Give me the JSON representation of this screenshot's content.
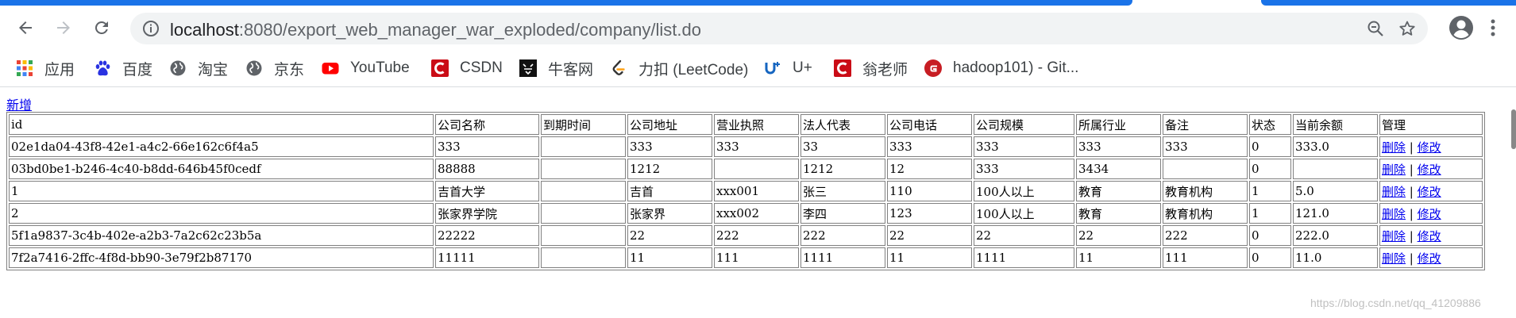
{
  "browser": {
    "url_host": "localhost",
    "url_path": ":8080/export_web_manager_war_exploded/company/list.do",
    "accent": "#1a73e8"
  },
  "bookmarks": [
    {
      "label": "应用",
      "icon": "apps-grid-icon"
    },
    {
      "label": "百度",
      "icon": "baidu-icon"
    },
    {
      "label": "淘宝",
      "icon": "globe-icon"
    },
    {
      "label": "京东",
      "icon": "globe-icon"
    },
    {
      "label": "YouTube",
      "icon": "youtube-icon"
    },
    {
      "label": "CSDN",
      "icon": "csdn-icon"
    },
    {
      "label": "牛客网",
      "icon": "nowcoder-icon"
    },
    {
      "label": "力扣 (LeetCode)",
      "icon": "leetcode-icon"
    },
    {
      "label": "U+",
      "icon": "uplus-icon"
    },
    {
      "label": "翁老师",
      "icon": "csdn-icon"
    },
    {
      "label": "hadoop101) - Git...",
      "icon": "gitee-icon"
    }
  ],
  "page": {
    "add_link": "新增",
    "columns": [
      "id",
      "公司名称",
      "到期时间",
      "公司地址",
      "营业执照",
      "法人代表",
      "公司电话",
      "公司规模",
      "所属行业",
      "备注",
      "状态",
      "当前余额",
      "管理"
    ],
    "delete_label": "删除",
    "separator": "|",
    "edit_label": "修改",
    "rows": [
      [
        "02e1da04-43f8-42e1-a4c2-66e162c6f4a5",
        "333",
        "",
        "333",
        "333",
        "33",
        "333",
        "333",
        "333",
        "333",
        "0",
        "333.0"
      ],
      [
        "03bd0be1-b246-4c40-b8dd-646b45f0cedf",
        "88888",
        "",
        "1212",
        "",
        "1212",
        "12",
        "333",
        "3434",
        "",
        "0",
        ""
      ],
      [
        "1",
        "吉首大学",
        "",
        "吉首",
        "xxx001",
        "张三",
        "110",
        "100人以上",
        "教育",
        "教育机构",
        "1",
        "5.0"
      ],
      [
        "2",
        "张家界学院",
        "",
        "张家界",
        "xxx002",
        "李四",
        "123",
        "100人以上",
        "教育",
        "教育机构",
        "1",
        "121.0"
      ],
      [
        "5f1a9837-3c4b-402e-a2b3-7a2c62c23b5a",
        "22222",
        "",
        "22",
        "222",
        "222",
        "22",
        "22",
        "22",
        "222",
        "0",
        "222.0"
      ],
      [
        "7f2a7416-2ffc-4f8d-bb90-3e79f2b87170",
        "11111",
        "",
        "11",
        "111",
        "1111",
        "11",
        "1111",
        "11",
        "111",
        "0",
        "11.0"
      ]
    ]
  },
  "watermark": "https://blog.csdn.net/qq_41209886"
}
